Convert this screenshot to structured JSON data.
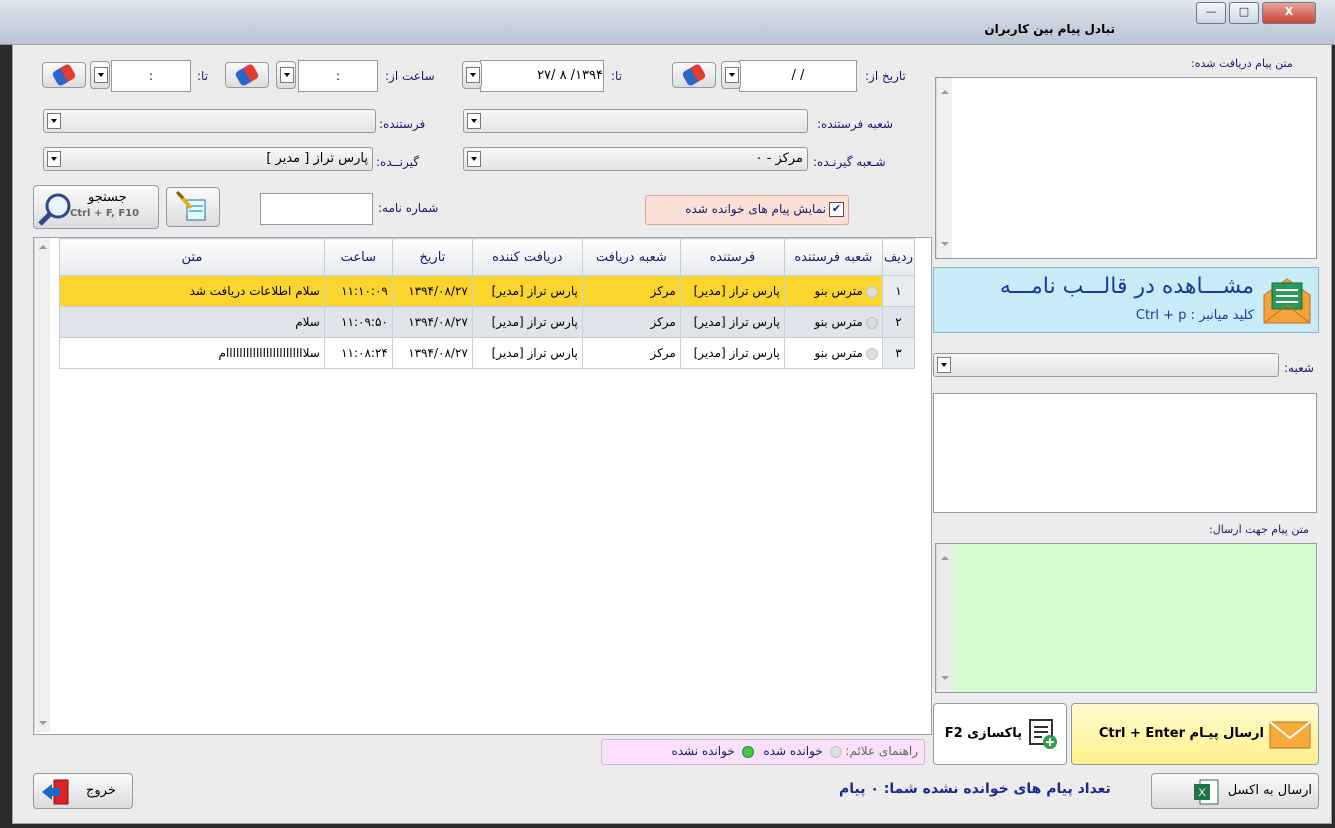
{
  "window": {
    "title": "تبادل پیام بین کاربران",
    "min_glyph": "—",
    "max_glyph": "□",
    "close_glyph": "X"
  },
  "filters": {
    "date_from_label": "تاریخ از:",
    "date_from_value": "/ /",
    "date_to_label": "تا:",
    "date_to_value": "۱۳۹۴/ ۸ /۲۷",
    "time_from_label": "ساعت از:",
    "time_from_value": ":",
    "time_to_label": "تا:",
    "time_to_value": ":",
    "sender_branch_label": "شعبه فرستنده:",
    "sender_label": "فرستنده:",
    "receiver_branch_label": "شـعبه گیرنـده:",
    "receiver_branch_value": "مرکز - ۰",
    "receiver_label": "گیرنــده:",
    "receiver_value": "پارس تراز [ مدیر ]",
    "letter_no_label": "شماره نامه:",
    "show_read_label": "نمایش پیام های خوانده شده",
    "search_label": "جستجو",
    "search_shortcut": "Ctrl + F, F10"
  },
  "table": {
    "columns": [
      "ردیف",
      "شعبه فرستنده",
      "فرستنده",
      "شعبه دریافت",
      "دریافت کننده",
      "تاریخ",
      "ساعت",
      "متن"
    ],
    "rows": [
      {
        "row": "۱",
        "sender_branch": "مترس بنو",
        "sender": "پارس تراز [مدیر]",
        "recv_branch": "مرکز",
        "receiver": "پارس تراز [مدیر]",
        "date": "۱۳۹۴/۰۸/۲۷",
        "time": "۱۱:۱۰:۰۹",
        "text": "سلام اطلاعات دریافت شد"
      },
      {
        "row": "۲",
        "sender_branch": "مترس بنو",
        "sender": "پارس تراز [مدیر]",
        "recv_branch": "مرکز",
        "receiver": "پارس تراز [مدیر]",
        "date": "۱۳۹۴/۰۸/۲۷",
        "time": "۱۱:۰۹:۵۰",
        "text": "سلام"
      },
      {
        "row": "۳",
        "sender_branch": "مترس بنو",
        "sender": "پارس تراز [مدیر]",
        "recv_branch": "مرکز",
        "receiver": "پارس تراز [مدیر]",
        "date": "۱۳۹۴/۰۸/۲۷",
        "time": "۱۱:۰۸:۲۴",
        "text": "سلاااااااااااااااااااااااام"
      }
    ]
  },
  "legend": {
    "title": "راهنمای علائم:",
    "read": "خوانده شده",
    "unread": "خوانده نشده"
  },
  "right_panel": {
    "received_text_label": "متن پیام دریافت شده:",
    "view_letter_label": "مشـــاهده در قالـــب نامـــه",
    "view_letter_shortcut": "کلید میانبر : Ctrl + p",
    "branch_label": "شعبه:",
    "send_text_label": "متن پیام جهت ارسال:",
    "send_button": "ارسال پیـام Ctrl + Enter",
    "clear_button": "پاکسازی F2"
  },
  "footer": {
    "exit_label": "خروج",
    "excel_label": "ارسال به اکسل",
    "unread_count_text": "تعداد پیام های خوانده نشده شما: ۰ پیام"
  },
  "colors": {
    "selected_row": "#f9d52d",
    "view_letter_bg": "#c8ecf7",
    "send_text_bg": "#d6fbd0",
    "send_button_bg": "#fff6a8",
    "legend_bg": "#fbe0fb",
    "show_read_bg": "#fbe0d6"
  }
}
